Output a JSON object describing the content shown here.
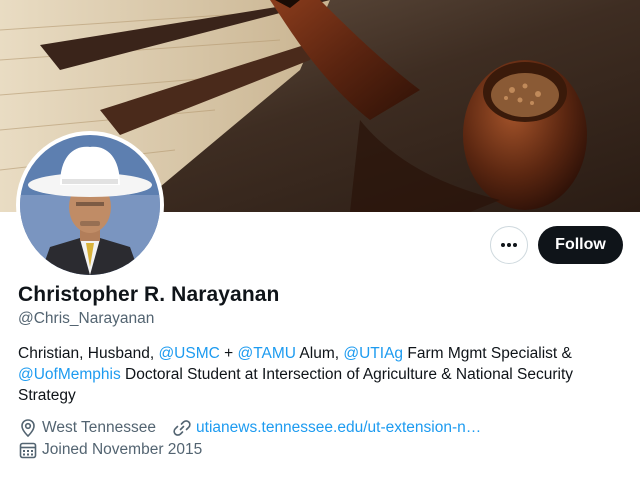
{
  "profile": {
    "name": "Christopher R. Narayanan",
    "handle": "@Chris_Narayanan",
    "follow_label": "Follow",
    "more_label": "•••",
    "bio": {
      "p1": "Christian, Husband, ",
      "m1": "@USMC",
      "p2": " + ",
      "m2": "@TAMU",
      "p3": " Alum, ",
      "m3": "@UTIAg",
      "p4": " Farm Mgmt Specialist & ",
      "m4": "@UofMemphis",
      "p5": " Doctoral Student at Intersection of Agriculture & National Security Strategy"
    },
    "location": "West Tennessee",
    "website": "utianews.tennessee.edu/ut-extension-n…",
    "joined": "Joined November 2015"
  },
  "colors": {
    "accent": "#1d9bf0",
    "text": "#0f1419",
    "secondary": "#536471",
    "button_dark": "#0f1419"
  },
  "icons": {
    "more": "more-icon",
    "location": "location-pin-icon",
    "link": "link-icon",
    "calendar": "calendar-icon"
  }
}
